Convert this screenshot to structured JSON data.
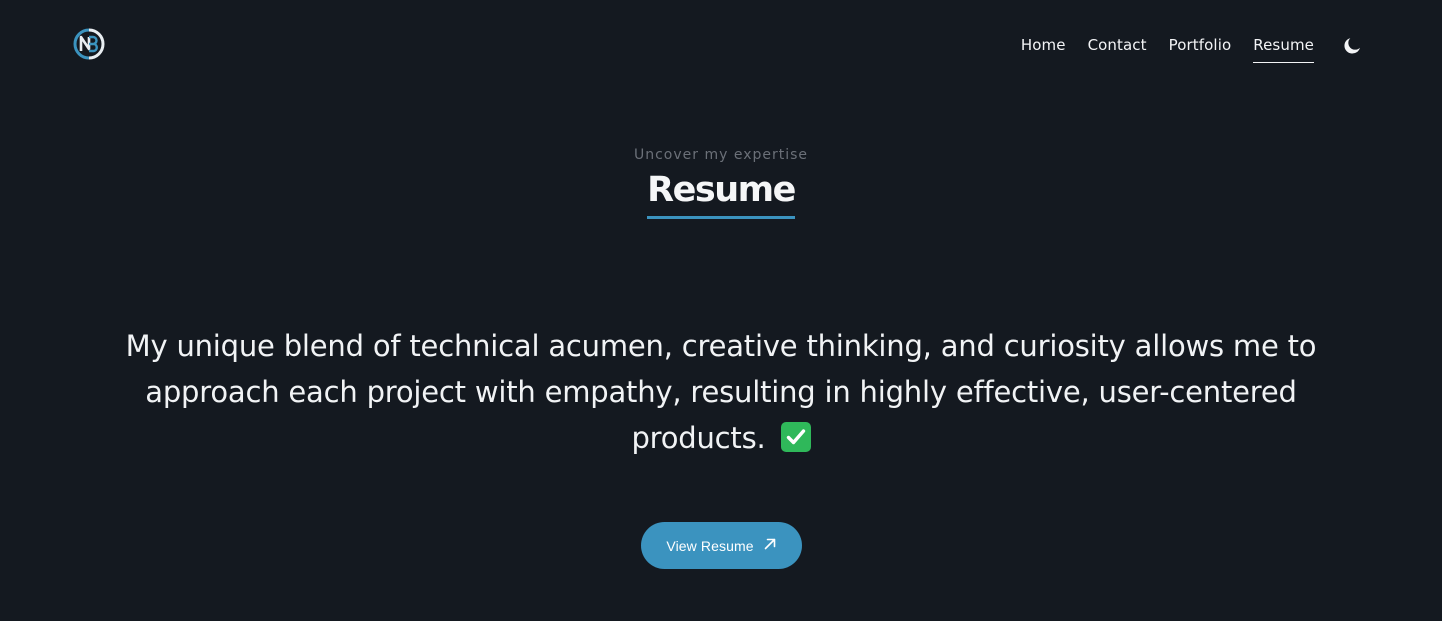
{
  "header": {
    "logo_alt": "NB",
    "nav": [
      {
        "label": "Home",
        "active": false
      },
      {
        "label": "Contact",
        "active": false
      },
      {
        "label": "Portfolio",
        "active": false
      },
      {
        "label": "Resume",
        "active": true
      }
    ],
    "theme_toggle_icon": "moon-icon"
  },
  "section": {
    "eyebrow": "Uncover my expertise",
    "title": "Resume"
  },
  "statement": {
    "text": "My unique blend of technical acumen, creative thinking, and curiosity allows me to approach each project with empathy, resulting in highly effective, user-centered products.",
    "emoji_icon": "check-mark-button-icon"
  },
  "cta": {
    "label": "View Resume",
    "icon": "arrow-up-right-icon"
  },
  "colors": {
    "background": "#141920",
    "accent": "#3b93bf",
    "text": "#f1f3f5",
    "muted": "#6b7078"
  }
}
